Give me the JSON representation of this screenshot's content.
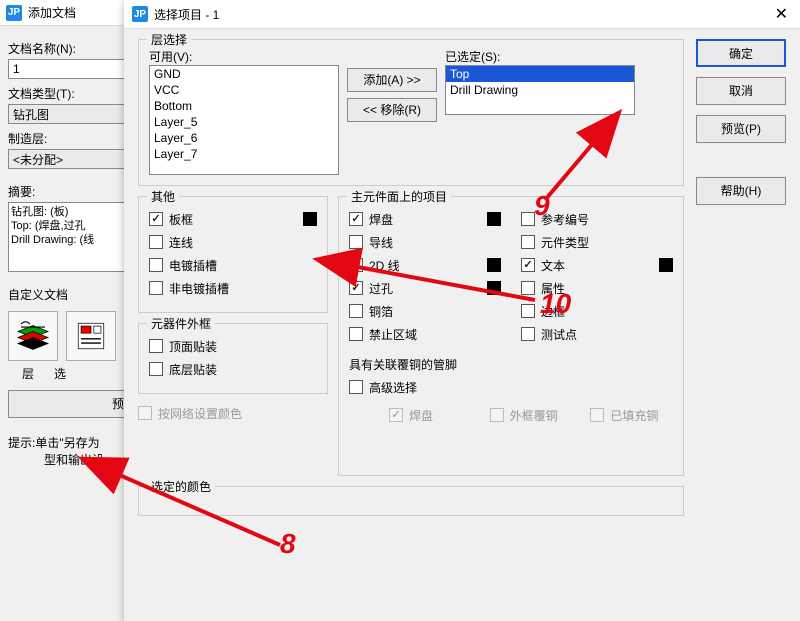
{
  "bg": {
    "title": "添加文档",
    "doc_name_lbl": "文档名称(N):",
    "doc_name_val": "1",
    "doc_type_lbl": "文档类型(T):",
    "doc_type_val": "钻孔图",
    "mfg_layer_lbl": "制造层:",
    "mfg_layer_val": "<未分配>",
    "summary_lbl": "摘要:",
    "summary_lines": [
      "钻孔图: (板)",
      "Top: (焊盘,过孔",
      "Drill Drawing: (线"
    ],
    "custom_lbl": "自定义文档",
    "col_layer_lbl": "层",
    "col_sel_lbl": "选",
    "preview_btn": "预览设",
    "tip_line1": "提示:单击\"另存为",
    "tip_line2": "型和输出设"
  },
  "fg": {
    "title": "选择项目 - 1",
    "group_layer": "层选择",
    "avail_lbl": "可用(V):",
    "avail_items": [
      "GND",
      "VCC",
      "Bottom",
      "Layer_5",
      "Layer_6",
      "Layer_7"
    ],
    "sel_lbl": "已选定(S):",
    "sel_items": [
      "Top",
      "Drill Drawing"
    ],
    "add_btn": "添加(A) >>",
    "remove_btn": "<< 移除(R)",
    "group_other": "其他",
    "other_items": [
      {
        "label": "板框",
        "checked": true,
        "swatch": true
      },
      {
        "label": "连线",
        "checked": false
      },
      {
        "label": "电镀插槽",
        "checked": false
      },
      {
        "label": "非电镀插槽",
        "checked": false
      }
    ],
    "group_outline": "元器件外框",
    "outline_items": [
      {
        "label": "顶面贴装",
        "checked": false
      },
      {
        "label": "底层贴装",
        "checked": false
      }
    ],
    "by_net_color": "按网络设置颜色",
    "group_primary": "主元件面上的项目",
    "primary_items_col1": [
      {
        "label": "焊盘",
        "checked": true,
        "swatch": true
      },
      {
        "label": "导线",
        "checked": false
      },
      {
        "label": "2D 线",
        "checked": true,
        "swatch": true
      },
      {
        "label": "过孔",
        "checked": true,
        "swatch": true
      },
      {
        "label": "铜箔",
        "checked": false
      },
      {
        "label": "禁止区域",
        "checked": false
      }
    ],
    "primary_items_col2": [
      {
        "label": "参考编号",
        "checked": false
      },
      {
        "label": "元件类型",
        "checked": false
      },
      {
        "label": "文本",
        "checked": true,
        "swatch": true
      },
      {
        "label": "属性",
        "checked": false
      },
      {
        "label": "边框",
        "checked": false
      },
      {
        "label": "测试点",
        "checked": false
      }
    ],
    "assoc_copper_lbl": "具有关联覆铜的管脚",
    "adv_sel": "高级选择",
    "adv_items": [
      {
        "label": "焊盘",
        "checked": true,
        "dis": true
      },
      {
        "label": "外框覆铜",
        "checked": false,
        "dis": true
      },
      {
        "label": "已填充铜",
        "checked": false,
        "dis": true
      }
    ],
    "group_selcolor": "选定的颜色",
    "btn_ok": "确定",
    "btn_cancel": "取消",
    "btn_preview": "预览(P)",
    "btn_help": "帮助(H)"
  },
  "annot": {
    "n8": "8",
    "n9": "9",
    "n10": "10"
  }
}
